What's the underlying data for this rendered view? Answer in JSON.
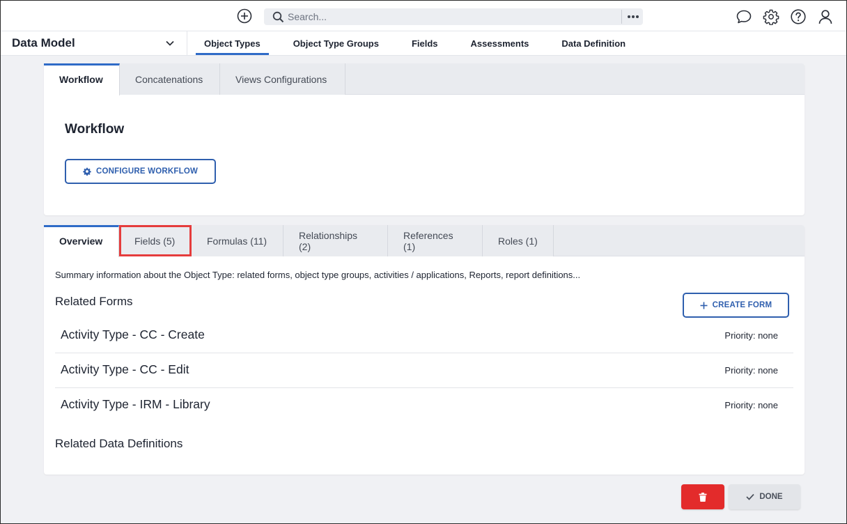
{
  "colors": {
    "accent": "#2f6bc7",
    "button_outline": "#2f5fae",
    "delete": "#e32b2b",
    "highlight": "#e53c3c"
  },
  "topbar": {
    "add_icon": "plus-circle-icon",
    "search": {
      "placeholder": "Search...",
      "more_icon": "more-horizontal-icon"
    },
    "icons": [
      "chat-bubble-icon",
      "gear-icon",
      "help-circle-icon",
      "user-icon"
    ]
  },
  "subnav": {
    "module": "Data Model",
    "tabs": [
      {
        "label": "Object Types",
        "active": true
      },
      {
        "label": "Object Type Groups"
      },
      {
        "label": "Fields"
      },
      {
        "label": "Assessments"
      },
      {
        "label": "Data Definition"
      }
    ]
  },
  "workflow_card": {
    "tabs": [
      {
        "label": "Workflow",
        "active": true
      },
      {
        "label": "Concatenations"
      },
      {
        "label": "Views Configurations"
      }
    ],
    "title": "Workflow",
    "configure_label": "CONFIGURE WORKFLOW"
  },
  "overview_card": {
    "tabs": [
      {
        "label": "Overview",
        "active": true
      },
      {
        "label": "Fields (5)",
        "highlighted": true
      },
      {
        "label": "Formulas (11)"
      },
      {
        "label": "Relationships (2)"
      },
      {
        "label": "References (1)"
      },
      {
        "label": "Roles (1)"
      }
    ],
    "summary": "Summary information about the Object Type: related forms, object type groups, activities / applications, Reports, report definitions...",
    "related_forms_heading": "Related Forms",
    "create_form_label": "CREATE FORM",
    "forms": [
      {
        "name": "Activity Type - CC - Create",
        "priority": "Priority: none"
      },
      {
        "name": "Activity Type - CC - Edit",
        "priority": "Priority: none"
      },
      {
        "name": "Activity Type - IRM - Library",
        "priority": "Priority: none"
      }
    ],
    "related_data_definitions_heading": "Related Data Definitions"
  },
  "footer": {
    "delete_icon": "trash-icon",
    "done_label": "DONE"
  }
}
